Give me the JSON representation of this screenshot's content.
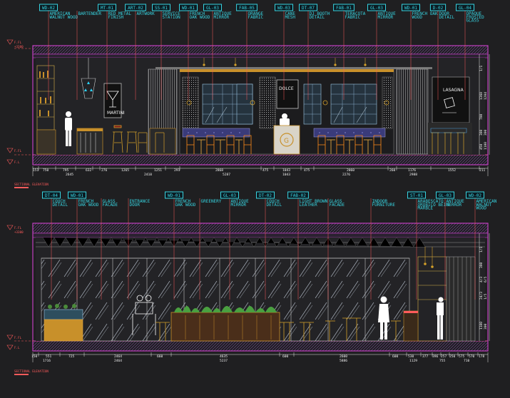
{
  "sections": [
    {
      "name": "upper-elevation",
      "tags": [
        {
          "code": "WD-02",
          "note": "AMERICAN\nWALNUT WOOD"
        },
        {
          "code": "",
          "note": "BARTENDER"
        },
        {
          "code": "MT-01",
          "note": "RED METAL\nFINISH"
        },
        {
          "code": "ART-02",
          "note": "ARTWORK"
        },
        {
          "code": "SS-01",
          "note": "SERVICE\nSTATION"
        },
        {
          "code": "WD-01",
          "note": "FRENCH\nOAK WOOD"
        },
        {
          "code": "GL-03",
          "note": "ANTIQUE\nMIRROR"
        },
        {
          "code": "FAB-05",
          "note": "ORANGE\nFABRIC"
        },
        {
          "code": "WD-03",
          "note": "CANE\nMESH"
        },
        {
          "code": "DT-07",
          "note": "DJ BOOTH\nDETAIL"
        },
        {
          "code": "FAB-01",
          "note": "TERACOTA\nFABRIC"
        },
        {
          "code": "GL-03",
          "note": "ANTIQUE\nMIRROR"
        },
        {
          "code": "WD-01",
          "note": "FRENCH OAK\nWOOD"
        },
        {
          "code": "D-02",
          "note": "DOOR\nDETAIL"
        },
        {
          "code": "GL-04",
          "note": "OPAQUE\nFROSTED\nGLASS"
        }
      ],
      "dims": [
        "151",
        "750",
        "795",
        "632",
        "276",
        "1265",
        "1251",
        "291",
        "2868",
        "475",
        "1043",
        "475",
        "2060",
        "260",
        "1176",
        "1552",
        "211"
      ],
      "subdims": [
        "2645",
        "2410",
        "5287",
        "1043",
        "2276",
        "2988"
      ],
      "signs": {
        "martini": "MARTINI",
        "dolce": "DOLCE",
        "lasagna": "LASAGNA"
      },
      "heights": [
        "1/1",
        "1360",
        "1204",
        "700",
        "300",
        "300",
        "450",
        "1100"
      ],
      "caption": "SECTIONAL ELEVATION"
    },
    {
      "name": "lower-elevation",
      "tags": [
        {
          "code": "DT-04",
          "note": "COUCH\nDETAIL"
        },
        {
          "code": "WD-01",
          "note": "FRENCH\nOAK WOOD"
        },
        {
          "code": "",
          "note": "GLASS\nFACADE"
        },
        {
          "code": "",
          "note": "ENTRANCE\nDOOR"
        },
        {
          "code": "WD-01",
          "note": "FRENCH\nOAK WOOD"
        },
        {
          "code": "",
          "note": "GREENERY"
        },
        {
          "code": "GL-03",
          "note": "ANTIQUE\nMIRROR"
        },
        {
          "code": "DT-02",
          "note": "COUCH\nDETAIL"
        },
        {
          "code": "FAB-02",
          "note": "LIGHT BROWN\nLEATHER"
        },
        {
          "code": "",
          "note": "GLASS\nFACADE"
        },
        {
          "code": "",
          "note": "INDOOR\nFURNITURE"
        },
        {
          "code": "ST-01",
          "note": "ARABESCATO\nOROBICO BEIGE\nMARBLE"
        },
        {
          "code": "GL-03",
          "note": "ANTIQUE\nMIRROR"
        },
        {
          "code": "WD-02",
          "note": "AMERICAN\nWALNUT\nWOOD"
        }
      ],
      "dims": [
        "150",
        "551",
        "725",
        "2464",
        "660",
        "4635",
        "600",
        "2600",
        "600",
        "530",
        "377",
        "396",
        "257",
        "250",
        "575",
        "570",
        "178"
      ],
      "subdims": [
        "1716",
        "2464",
        "5237",
        "5886",
        "1129",
        "755",
        "710"
      ],
      "heights": [
        "1/1",
        "300",
        "4/3",
        "6/5",
        "24/3",
        "1/5",
        "1100",
        "300"
      ],
      "caption": "SECTIONAL ELEVATION"
    }
  ],
  "levels": {
    "ffl": "F.FL",
    "fl": "F.L",
    "top": "+3300"
  },
  "colors": {
    "tag": "#37d3e0",
    "note": "#e8e8e8",
    "level": "#ff5b5b",
    "frame": "#c040c0",
    "floor": "#5a2d7a",
    "wood": "#c8902a",
    "glass": "#9ec8e8",
    "mirror": "#9cc4dc"
  }
}
